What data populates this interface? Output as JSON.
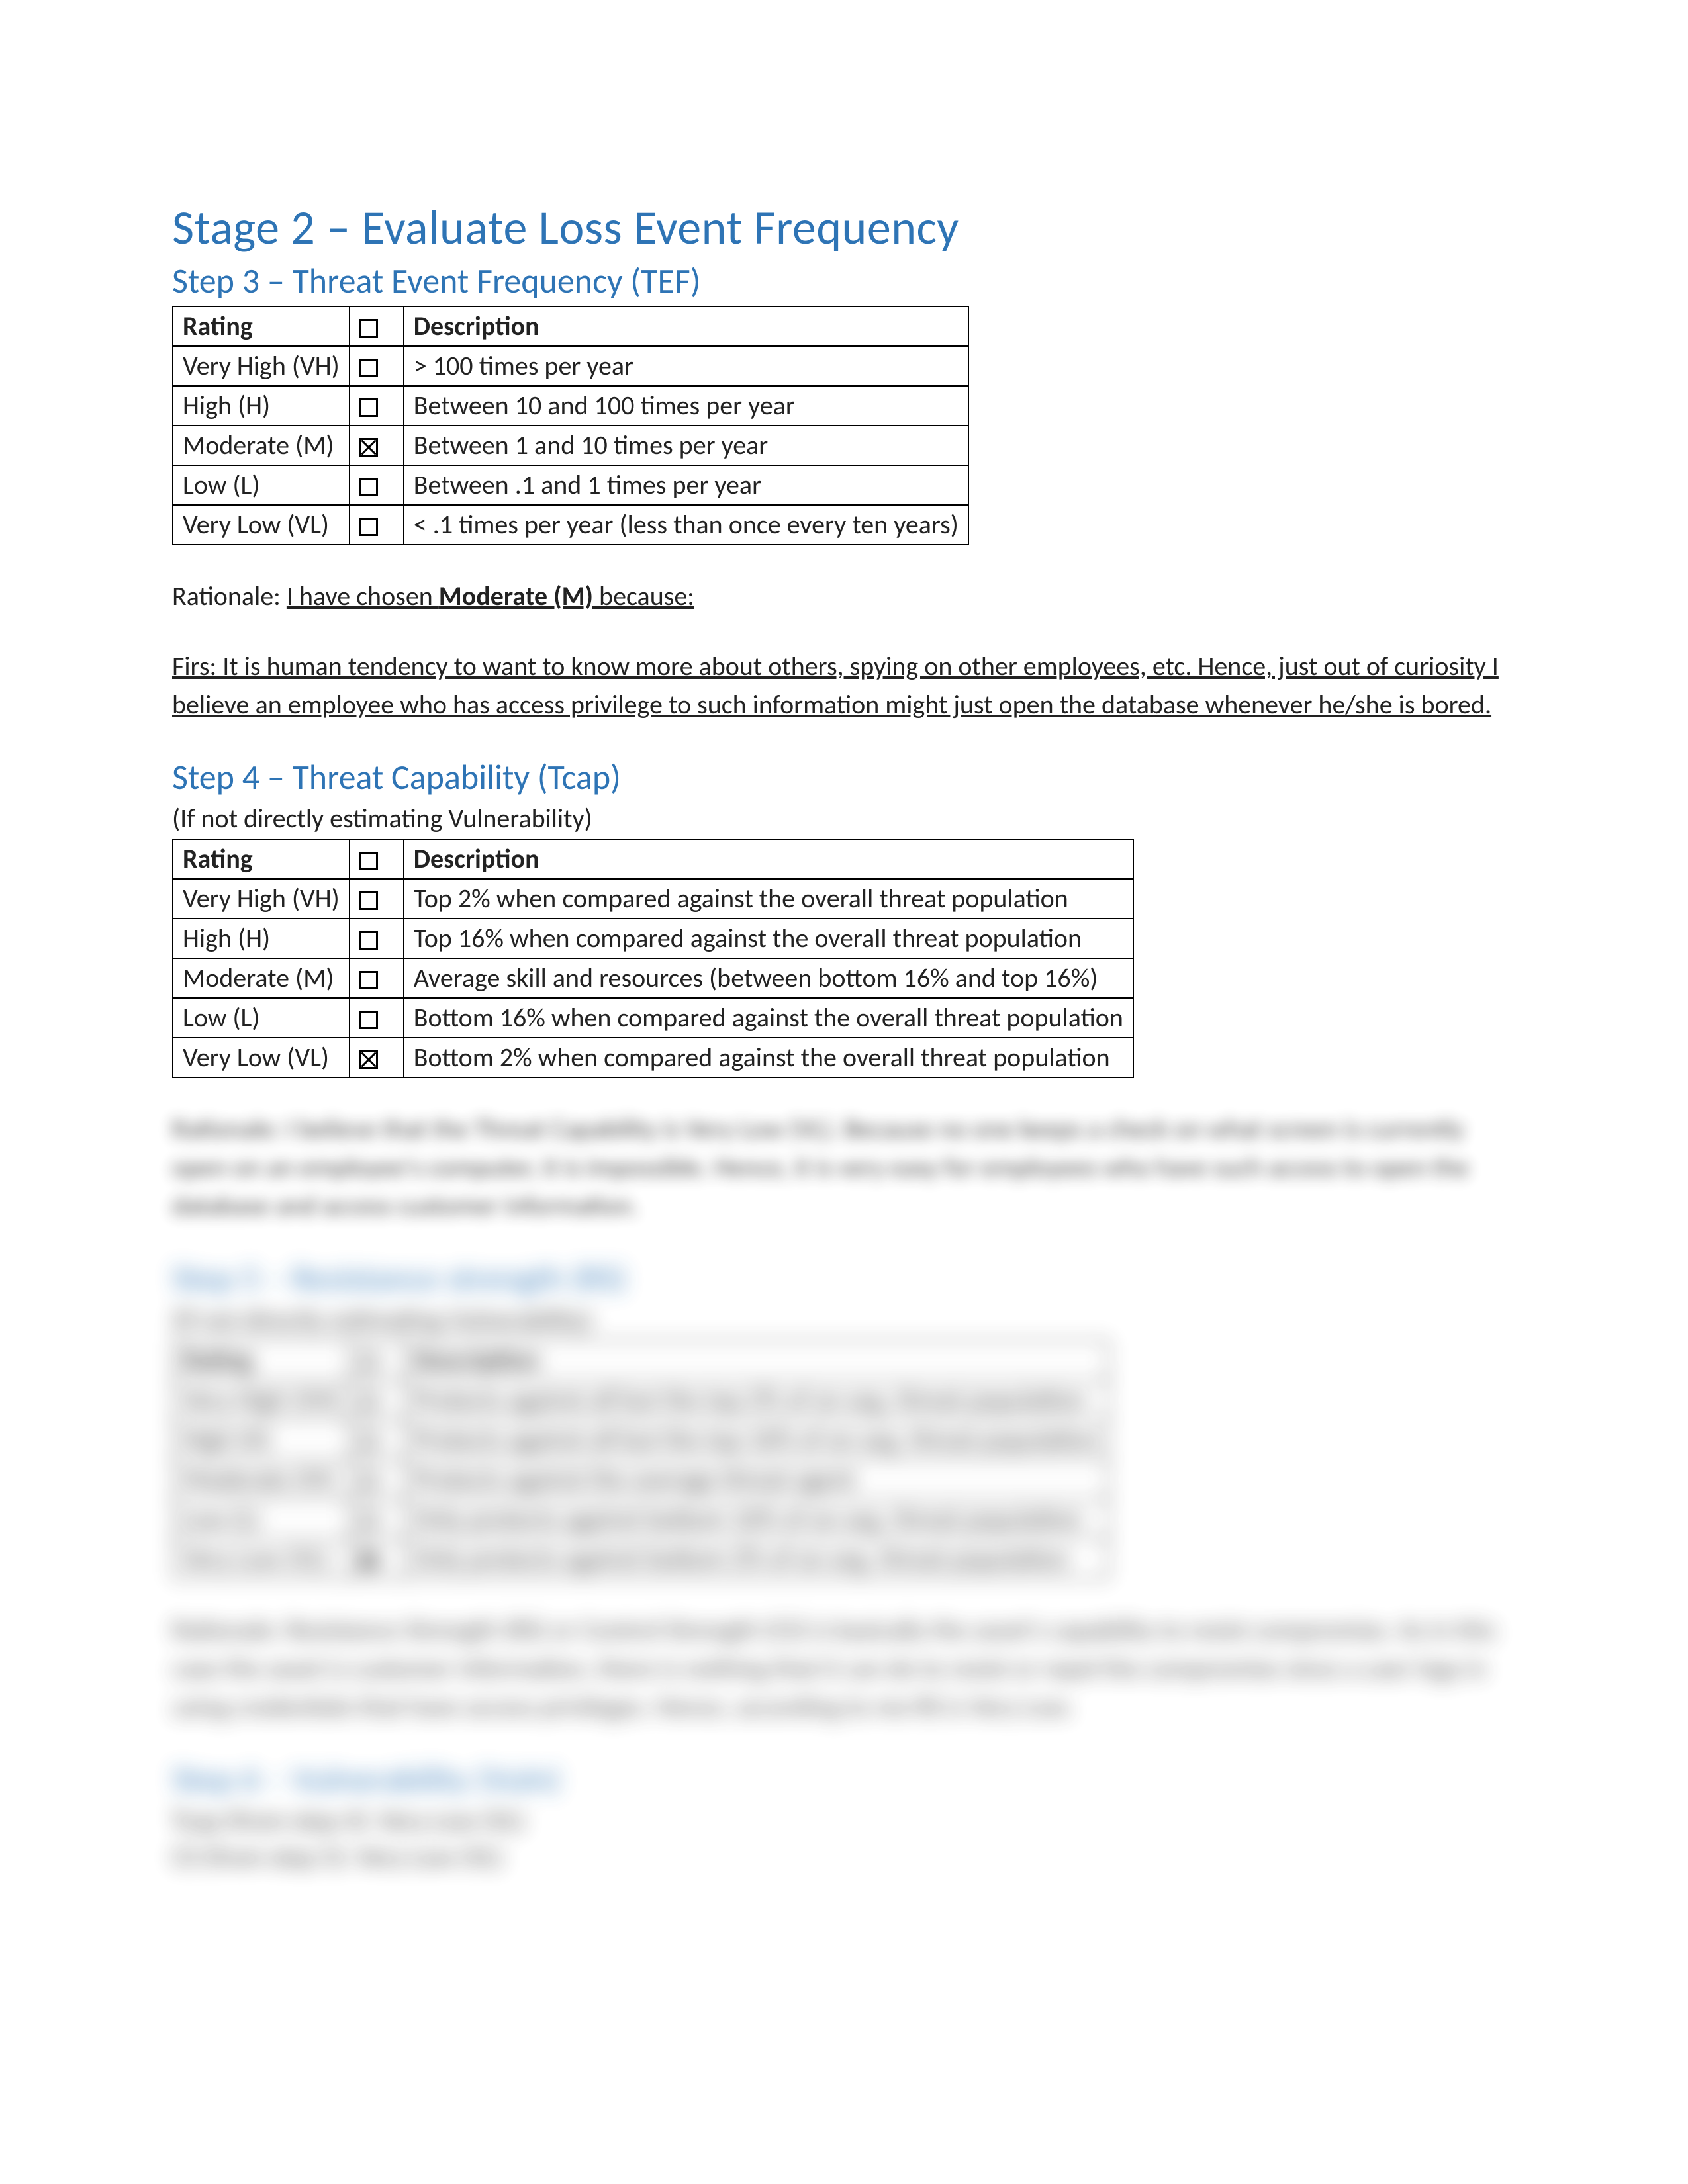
{
  "stage_title": "Stage 2 – Evaluate Loss Event Frequency",
  "step3": {
    "heading": "Step 3 – Threat Event Frequency (TEF)",
    "cols": {
      "rating": "Rating",
      "description": "Description"
    },
    "rows": [
      {
        "rating": "Very High (VH)",
        "checked": false,
        "desc": "> 100 times per year"
      },
      {
        "rating": "High (H)",
        "checked": false,
        "desc": "Between 10 and 100 times per year"
      },
      {
        "rating": "Moderate (M)",
        "checked": true,
        "desc": "Between 1 and 10 times per year"
      },
      {
        "rating": "Low (L)",
        "checked": false,
        "desc": "Between .1 and 1 times per year"
      },
      {
        "rating": "Very Low (VL)",
        "checked": false,
        "desc": "< .1 times per year (less than once every ten years)"
      }
    ],
    "rationale_prefix": "Rationale: ",
    "rationale_line": "I have chosen Moderate (M) because:",
    "rationale_bold": "Moderate (M)",
    "body": "Firs: It is human tendency to want to know more about others, spying on other employees, etc. Hence, just out of curiosity I believe an employee who has access privilege to such information might just open the database whenever he/she is bored."
  },
  "step4": {
    "heading": "Step 4 – Threat Capability (Tcap)",
    "subnote": "(If not directly estimating Vulnerability)",
    "cols": {
      "rating": "Rating",
      "description": "Description"
    },
    "rows": [
      {
        "rating": "Very High (VH)",
        "checked": false,
        "desc": "Top 2% when compared against the overall threat population"
      },
      {
        "rating": "High (H)",
        "checked": false,
        "desc": "Top 16% when compared against the overall threat population"
      },
      {
        "rating": "Moderate (M)",
        "checked": false,
        "desc": "Average skill and resources (between bottom 16% and top 16%)"
      },
      {
        "rating": "Low (L)",
        "checked": false,
        "desc": "Bottom 16% when compared against the overall threat population"
      },
      {
        "rating": "Very Low (VL)",
        "checked": true,
        "desc": "Bottom 2% when compared against the overall threat population"
      }
    ],
    "blurred_rationale": "Rationale: I believe that the Threat Capability is Very Low (VL). Because no one keeps a check on what screen is currently open on an employee's computer, it is impossible. Hence, it is very easy for employees who have such access to open the database and access customer information."
  },
  "step5": {
    "heading": "Step 5 – Resistance strength (RS)",
    "subnote": "(If not directly estimating Vulnerability)",
    "cols": {
      "rating": "Rating",
      "description": "Description"
    },
    "rows": [
      {
        "rating": "Very High (VH)",
        "checked": false,
        "desc": "Protects against all but the top 2% of an avg. threat population"
      },
      {
        "rating": "High (H)",
        "checked": false,
        "desc": "Protects against all but the top 16% of an avg. threat population"
      },
      {
        "rating": "Moderate (M)",
        "checked": false,
        "desc": "Protects against the average threat agent"
      },
      {
        "rating": "Low (L)",
        "checked": false,
        "desc": "Only protects against bottom 16% of an avg. threat population"
      },
      {
        "rating": "Very Low (VL)",
        "checked": true,
        "desc": "Only protects against bottom 2% of an avg. threat population"
      }
    ],
    "blurred_rationale": "Rationale: Resistance Strength (RS) or Control Strength (CS) is basically the asset's capability to resist compromise. As in this case the asset is customer information, there is nothing that it can do to resist or repel the compromise since a user logs in using credentials that have access privileges. Hence, according to me RS is Very Low."
  },
  "step6": {
    "heading": "Step 6 – Vulnerability (Vuln)",
    "line1": "Tcap (from step 4): Very Low (VL)",
    "line2": "CS (from step 5): Very Low (VL)"
  }
}
